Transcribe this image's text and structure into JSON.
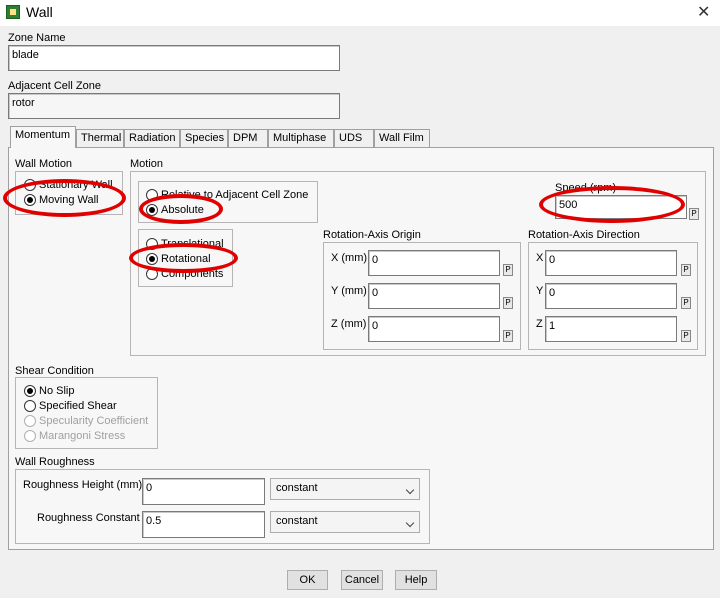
{
  "window": {
    "title": "Wall",
    "close_glyph": "✕"
  },
  "zone_name": {
    "label": "Zone Name",
    "value": "blade"
  },
  "adjacent_cell_zone": {
    "label": "Adjacent Cell Zone",
    "value": "rotor"
  },
  "tabs": [
    {
      "label": "Momentum",
      "active": true
    },
    {
      "label": "Thermal"
    },
    {
      "label": "Radiation"
    },
    {
      "label": "Species"
    },
    {
      "label": "DPM"
    },
    {
      "label": "Multiphase"
    },
    {
      "label": "UDS"
    },
    {
      "label": "Wall Film"
    }
  ],
  "wall_motion": {
    "label": "Wall Motion",
    "options": [
      {
        "label": "Stationary Wall",
        "selected": false
      },
      {
        "label": "Moving Wall",
        "selected": true
      }
    ]
  },
  "motion": {
    "label": "Motion",
    "reference": [
      {
        "label": "Relative to Adjacent Cell Zone",
        "selected": false
      },
      {
        "label": "Absolute",
        "selected": true
      }
    ],
    "type": [
      {
        "label": "Translational",
        "selected": false
      },
      {
        "label": "Rotational",
        "selected": true
      },
      {
        "label": "Components",
        "selected": false
      }
    ],
    "speed": {
      "label": "Speed (rpm)",
      "value": "500"
    }
  },
  "rotation_axis_origin": {
    "label": "Rotation-Axis Origin",
    "x": {
      "label": "X (mm)",
      "value": "0"
    },
    "y": {
      "label": "Y (mm)",
      "value": "0"
    },
    "z": {
      "label": "Z (mm)",
      "value": "0"
    }
  },
  "rotation_axis_direction": {
    "label": "Rotation-Axis Direction",
    "x": {
      "label": "X",
      "value": "0"
    },
    "y": {
      "label": "Y",
      "value": "0"
    },
    "z": {
      "label": "Z",
      "value": "1"
    }
  },
  "p_label": "P",
  "shear_condition": {
    "label": "Shear Condition",
    "options": [
      {
        "label": "No Slip",
        "selected": true,
        "enabled": true
      },
      {
        "label": "Specified Shear",
        "selected": false,
        "enabled": true
      },
      {
        "label": "Specularity Coefficient",
        "selected": false,
        "enabled": false
      },
      {
        "label": "Marangoni Stress",
        "selected": false,
        "enabled": false
      }
    ]
  },
  "wall_roughness": {
    "label": "Wall Roughness",
    "height": {
      "label": "Roughness Height (mm)",
      "value": "0",
      "method": "constant"
    },
    "constant": {
      "label": "Roughness Constant",
      "value": "0.5",
      "method": "constant"
    }
  },
  "buttons": {
    "ok": "OK",
    "cancel": "Cancel",
    "help": "Help"
  },
  "colors": {
    "annotation": "#e00000",
    "dialog_bg": "#f0f0f0"
  },
  "icons": {
    "app": "fluent-app-icon",
    "close": "close-icon",
    "dropdown": "chevron-down-icon"
  }
}
